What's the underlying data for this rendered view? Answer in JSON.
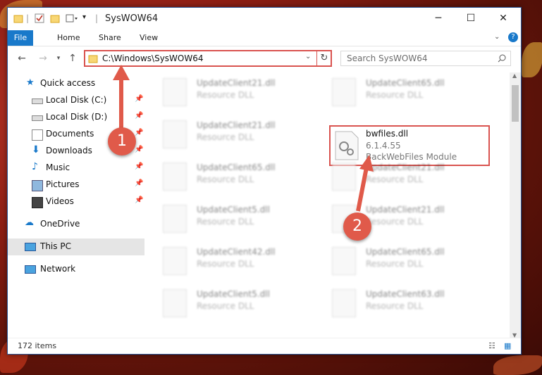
{
  "colors": {
    "accent": "#1979ca",
    "highlight": "#d9534f",
    "badge": "#e05a4a"
  },
  "window": {
    "title": "SysWOW64"
  },
  "ribbon": {
    "tabs": [
      {
        "label": "File"
      },
      {
        "label": "Home"
      },
      {
        "label": "Share"
      },
      {
        "label": "View"
      }
    ]
  },
  "address": {
    "path": "C:\\Windows\\SysWOW64"
  },
  "search": {
    "placeholder": "Search SysWOW64"
  },
  "nav": {
    "quick_access": "Quick access",
    "items": [
      {
        "label": "Local Disk (C:)",
        "icon": "drive-icon"
      },
      {
        "label": "Local Disk (D:)",
        "icon": "drive-icon"
      },
      {
        "label": "Documents",
        "icon": "documents-icon"
      },
      {
        "label": "Downloads",
        "icon": "downloads-icon"
      },
      {
        "label": "Music",
        "icon": "music-icon"
      },
      {
        "label": "Pictures",
        "icon": "pictures-icon"
      },
      {
        "label": "Videos",
        "icon": "videos-icon"
      }
    ],
    "onedrive": "OneDrive",
    "this_pc": "This PC",
    "network": "Network"
  },
  "files": {
    "left": [
      {
        "name": "UpdateClient21.dll",
        "type": "Resource DLL"
      },
      {
        "name": "UpdateClient21.dll",
        "type": "Resource DLL"
      },
      {
        "name": "UpdateClient65.dll",
        "type": "Resource DLL"
      },
      {
        "name": "UpdateClient5.dll",
        "type": "Resource DLL"
      },
      {
        "name": "UpdateClient42.dll",
        "type": "Resource DLL"
      },
      {
        "name": "UpdateClient5.dll",
        "type": "Resource DLL"
      }
    ],
    "right": [
      {
        "name": "UpdateClient65.dll",
        "type": "Resource DLL"
      },
      {
        "name": "UpdateClient21.dll",
        "type": "Resource DLL"
      },
      {
        "name": "UpdateClient21.dll",
        "type": "Resource DLL"
      },
      {
        "name": "UpdateClient65.dll",
        "type": "Resource DLL"
      },
      {
        "name": "UpdateClient63.dll",
        "type": "Resource DLL"
      }
    ],
    "highlighted": {
      "name": "bwfiles.dll",
      "version": "6.1.4.55",
      "description": "BackWebFiles Module"
    }
  },
  "status": {
    "count": "172 items"
  },
  "annotations": {
    "step1": "1",
    "step2": "2"
  }
}
